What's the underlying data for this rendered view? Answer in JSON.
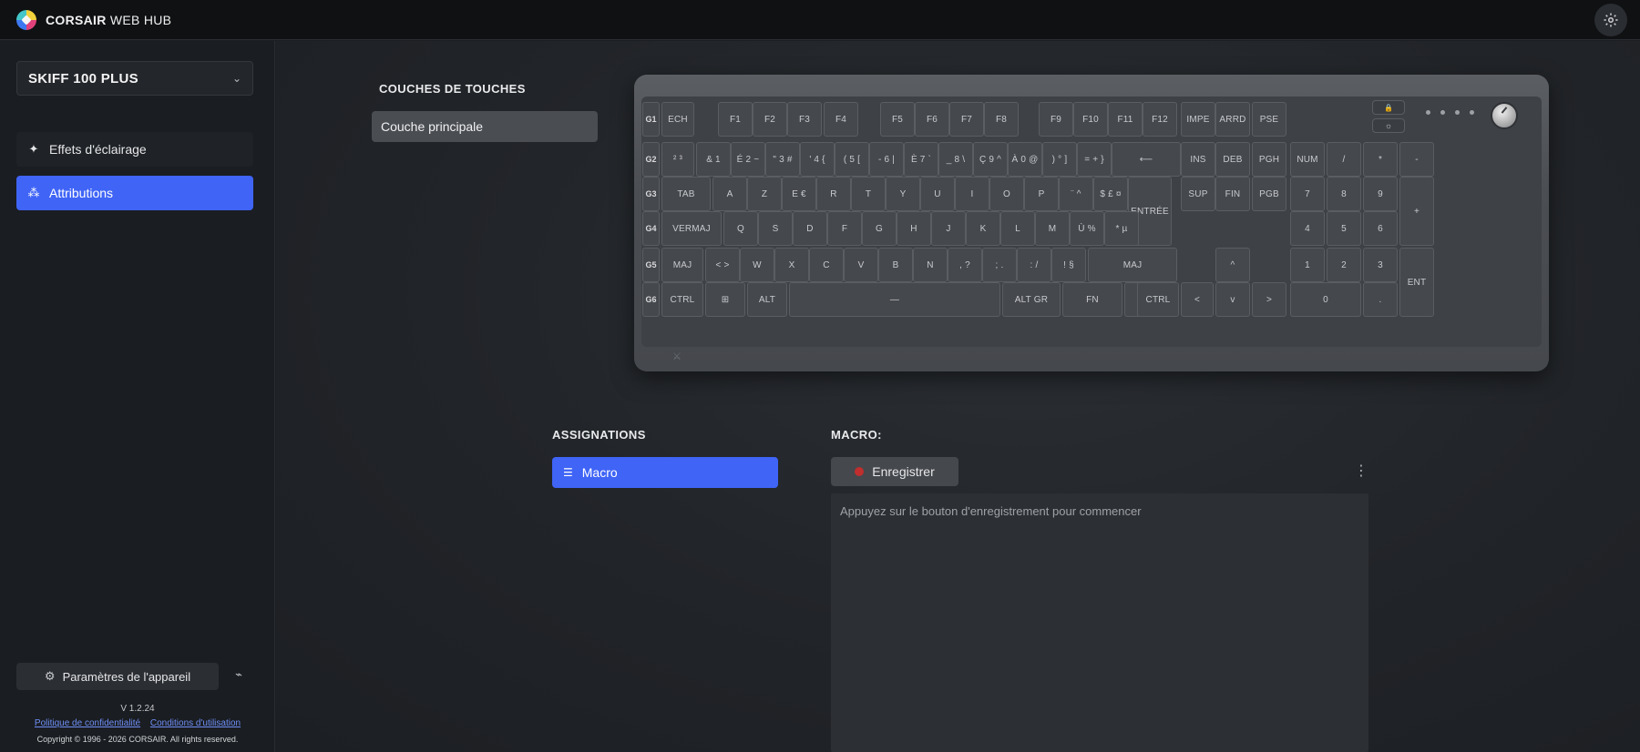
{
  "app": {
    "brand_bold": "CORSAIR",
    "brand_light": " WEB HUB"
  },
  "sidebar": {
    "device_name": "SKIFF 100 PLUS",
    "items": [
      {
        "label": "Effets d'éclairage",
        "icon": "sparkle-icon"
      },
      {
        "label": "Attributions",
        "icon": "assignments-icon"
      }
    ],
    "device_settings_label": "Paramètres de l'appareil",
    "version": "V 1.2.24",
    "privacy_link": "Politique de confidentialité",
    "terms_link": "Conditions d'utilisation",
    "copyright": "Copyright © 1996 - 2026 CORSAIR. All rights reserved."
  },
  "layers": {
    "title": "COUCHES DE TOUCHES",
    "selected": "Couche principale"
  },
  "keyboard": {
    "g_keys": [
      "G1",
      "G2",
      "G3",
      "G4",
      "G5",
      "G6"
    ],
    "rows": [
      [
        "ECH",
        "F1",
        "F2",
        "F3",
        "F4",
        "F5",
        "F6",
        "F7",
        "F8",
        "F9",
        "F10",
        "F11",
        "F12",
        "IMPE",
        "ARRD",
        "PSE"
      ],
      [
        "² ³",
        "& 1",
        "É 2 ~",
        "\" 3 #",
        "' 4 {",
        "( 5 [",
        "- 6 |",
        "È 7 `",
        "_ 8 \\",
        "Ç 9 ^",
        "À 0 @",
        ") ° ]",
        "= + }",
        "⟵",
        "INS",
        "DEB",
        "PGH",
        "NUM",
        "/",
        "*",
        "-"
      ],
      [
        "TAB",
        "A",
        "Z",
        "E €",
        "R",
        "T",
        "Y",
        "U",
        "I",
        "O",
        "P",
        "¨ ^",
        "$ £ ¤",
        "ENTRÉE",
        "SUP",
        "FIN",
        "PGB",
        "7",
        "8",
        "9",
        "+"
      ],
      [
        "VERMAJ",
        "Q",
        "S",
        "D",
        "F",
        "G",
        "H",
        "J",
        "K",
        "L",
        "M",
        "Ù %",
        "* µ",
        "4",
        "5",
        "6"
      ],
      [
        "MAJ",
        "< >",
        "W",
        "X",
        "C",
        "V",
        "B",
        "N",
        ", ?",
        "; .",
        ": /",
        "! §",
        "MAJ",
        "^",
        "1",
        "2",
        "3",
        "ENT"
      ],
      [
        "CTRL",
        "⊞",
        "ALT",
        "—",
        "ALT GR",
        "FN",
        "▤",
        "CTRL",
        "<",
        "v",
        ">",
        "0",
        "."
      ]
    ],
    "brand_mark": "⚔"
  },
  "assignments": {
    "title": "ASSIGNATIONS",
    "selected": "Macro"
  },
  "macro": {
    "title": "MACRO:",
    "record_label": "Enregistrer",
    "placeholder": "Appuyez sur le bouton d'enregistrement pour commencer"
  },
  "colors": {
    "accent": "#3f64f6",
    "record": "#c02e2e"
  }
}
